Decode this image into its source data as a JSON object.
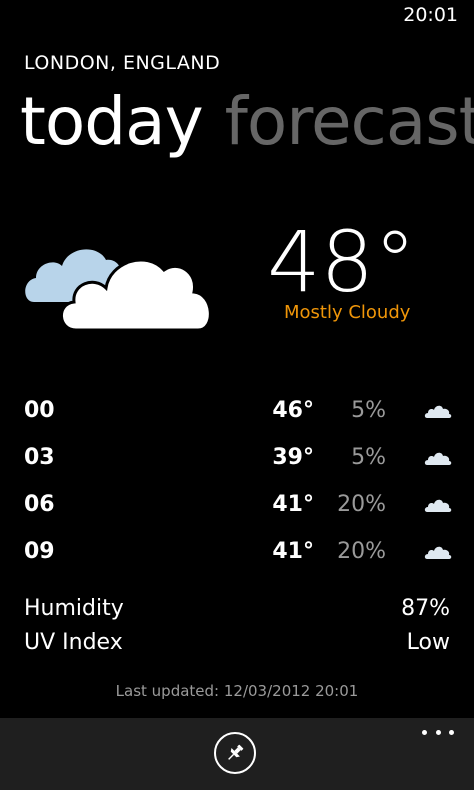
{
  "status_bar": {
    "time": "20:01"
  },
  "location": "LONDON, ENGLAND",
  "pivot": {
    "tabs": [
      {
        "label": "today",
        "active": true
      },
      {
        "label": "forecast",
        "active": false
      }
    ]
  },
  "current": {
    "temperature": "48°",
    "condition": "Mostly Cloudy",
    "icon": "mostly-cloudy-icon"
  },
  "hourly": [
    {
      "time": "00",
      "temp": "46°",
      "precip": "5%",
      "icon": "cloud-icon"
    },
    {
      "time": "03",
      "temp": "39°",
      "precip": "5%",
      "icon": "cloud-icon"
    },
    {
      "time": "06",
      "temp": "41°",
      "precip": "20%",
      "icon": "cloud-icon"
    },
    {
      "time": "09",
      "temp": "41°",
      "precip": "20%",
      "icon": "cloud-icon"
    }
  ],
  "stats": [
    {
      "label": "Humidity",
      "value": "87%"
    },
    {
      "label": "UV Index",
      "value": "Low"
    }
  ],
  "last_updated": "Last updated: 12/03/2012 20:01",
  "app_bar": {
    "pin_icon": "pin-icon",
    "more_icon": "more-icon"
  },
  "colors": {
    "background": "#000000",
    "accent": "#f09609",
    "inactive_text": "#666666",
    "secondary_text": "#9a9a9a",
    "cloud_white": "#ffffff",
    "cloud_blue": "#b8d4ea",
    "app_bar": "#1f1f1f"
  }
}
